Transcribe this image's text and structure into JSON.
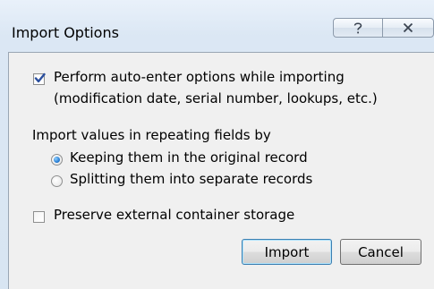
{
  "dialog": {
    "title": "Import Options",
    "help_icon": "question-mark-icon",
    "close_icon": "close-x-icon"
  },
  "options": {
    "auto_enter": {
      "line1": "Perform auto-enter options while importing",
      "line2": "(modification date, serial number, lookups, etc.)",
      "checked": true
    },
    "repeating_label": "Import values in repeating fields by",
    "repeating_choices": [
      {
        "label": "Keeping them in the original record",
        "selected": true
      },
      {
        "label": "Splitting them into separate records",
        "selected": false
      }
    ],
    "preserve_storage": {
      "label": "Preserve external container storage",
      "checked": false
    }
  },
  "buttons": {
    "import_label": "Import",
    "cancel_label": "Cancel"
  }
}
